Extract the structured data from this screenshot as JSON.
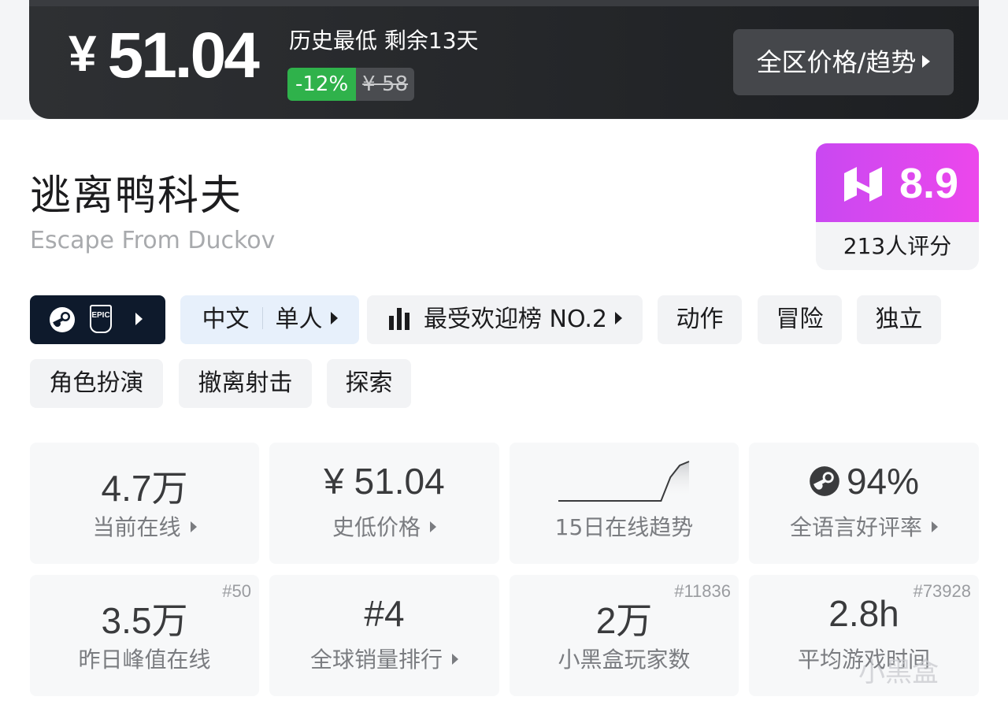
{
  "price": {
    "currency_symbol": "¥",
    "current": "51.04",
    "lowest_note": "历史最低 剩余13天",
    "discount": "-12%",
    "original": "¥ 58",
    "all_regions_button": "全区价格/趋势",
    "discount_color": "#2fb24b"
  },
  "game": {
    "title_cn": "逃离鸭科夫",
    "title_en": "Escape From Duckov"
  },
  "rating": {
    "score": "8.9",
    "count_label": "213人评分",
    "icon": "heybox-logo-icon",
    "accent": "#d84af0"
  },
  "tags": {
    "platforms": [
      "steam-icon",
      "epic-games-icon"
    ],
    "epic_label": "EPIC",
    "language": "中文",
    "mode": "单人",
    "ranking": "最受欢迎榜 NO.2",
    "genres": [
      "动作",
      "冒险",
      "独立",
      "角色扮演",
      "撤离射击",
      "探索"
    ]
  },
  "stats": [
    {
      "value": "4.7万",
      "label": "当前在线",
      "arrow": true,
      "rank": ""
    },
    {
      "value": "¥ 51.04",
      "label": "史低价格",
      "arrow": true,
      "rank": ""
    },
    {
      "value": "",
      "label": "15日在线趋势",
      "arrow": false,
      "rank": "",
      "trend": [
        0,
        0,
        0,
        0,
        0,
        0,
        0,
        0,
        0,
        0,
        0,
        0,
        0.6,
        0.9,
        1.0
      ]
    },
    {
      "value": "94%",
      "label": "全语言好评率",
      "arrow": true,
      "rank": "",
      "icon": "steam-icon"
    },
    {
      "value": "3.5万",
      "label": "昨日峰值在线",
      "arrow": false,
      "rank": "#50"
    },
    {
      "value": "#4",
      "label": "全球销量排行",
      "arrow": true,
      "rank": ""
    },
    {
      "value": "2万",
      "label": "小黑盒玩家数",
      "arrow": false,
      "rank": "#11836"
    },
    {
      "value": "2.8h",
      "label": "平均游戏时间",
      "arrow": false,
      "rank": "#73928"
    }
  ],
  "watermark": "小黑盒"
}
